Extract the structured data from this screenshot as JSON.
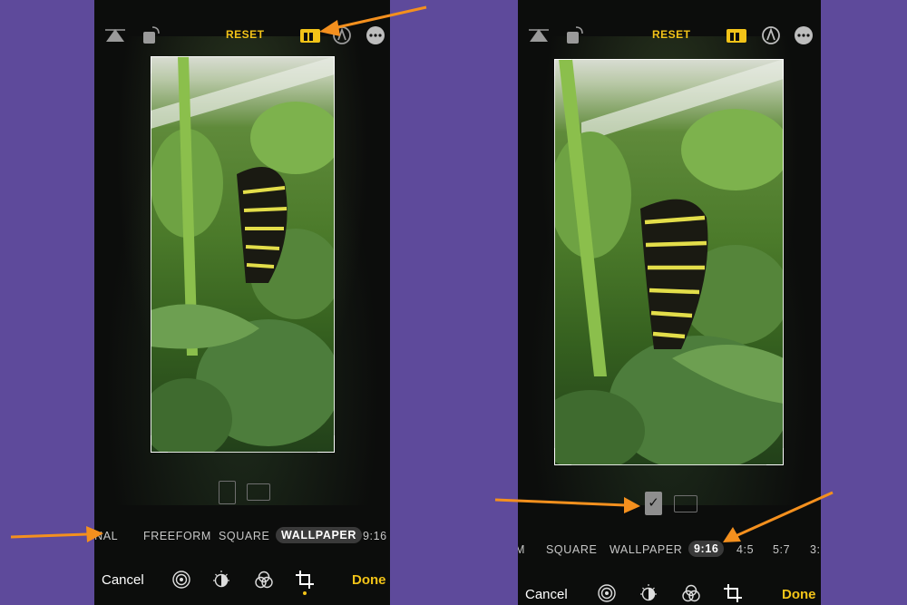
{
  "colors": {
    "background": "#5e4a9b",
    "accent_yellow": "#f2c318",
    "annotation_arrow": "#f4901e"
  },
  "left_screen": {
    "toolbar": {
      "reset_label": "RESET",
      "icons": [
        "perspective-icon",
        "rotate-icon",
        "aspect-ratio-icon",
        "markup-icon",
        "more-icon"
      ]
    },
    "aspect_options": {
      "items": [
        "INAL",
        "FREEFORM",
        "SQUARE",
        "WALLPAPER",
        "9:16"
      ],
      "selected": "WALLPAPER"
    },
    "bottom": {
      "cancel_label": "Cancel",
      "done_label": "Done",
      "tools": [
        "live-icon",
        "adjust-icon",
        "filters-icon",
        "crop-icon"
      ],
      "active_tool": "crop-icon"
    }
  },
  "right_screen": {
    "toolbar": {
      "reset_label": "RESET",
      "icons": [
        "perspective-icon",
        "rotate-icon",
        "aspect-ratio-icon",
        "markup-icon",
        "more-icon"
      ]
    },
    "orientation": {
      "portrait_selected": true,
      "check_mark": "✓"
    },
    "aspect_options": {
      "items": [
        "M",
        "SQUARE",
        "WALLPAPER",
        "9:16",
        "4:5",
        "5:7",
        "3:"
      ],
      "selected": "9:16"
    },
    "bottom": {
      "cancel_label": "Cancel",
      "done_label": "Done",
      "tools": [
        "live-icon",
        "adjust-icon",
        "filters-icon",
        "crop-icon"
      ],
      "active_tool": "crop-icon"
    }
  }
}
